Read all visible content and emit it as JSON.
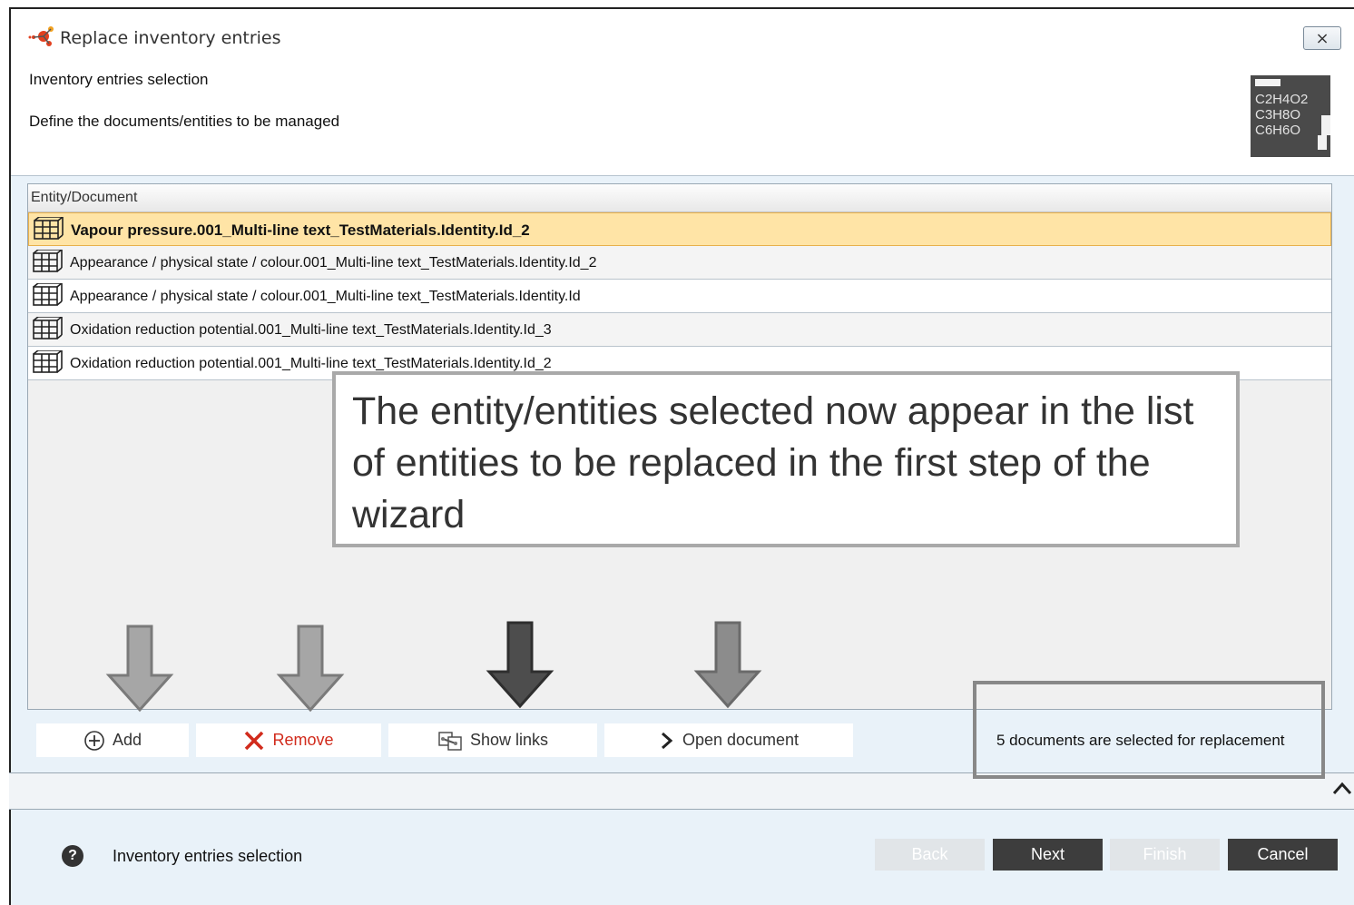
{
  "window": {
    "title": "Replace inventory entries",
    "close_label": "⨯"
  },
  "header": {
    "title": "Inventory entries selection",
    "subtitle": "Define the documents/entities to be managed",
    "logo_lines": [
      "C2H4O2",
      "C3H8O",
      "C6H6O"
    ]
  },
  "table": {
    "column_header": "Entity/Document",
    "rows": [
      "Vapour pressure.001_Multi-line text_TestMaterials.Identity.Id_2",
      "Appearance / physical state / colour.001_Multi-line text_TestMaterials.Identity.Id_2",
      "Appearance / physical state / colour.001_Multi-line text_TestMaterials.Identity.Id",
      "Oxidation reduction potential.001_Multi-line text_TestMaterials.Identity.Id_3",
      "Oxidation reduction potential.001_Multi-line text_TestMaterials.Identity.Id_2"
    ],
    "selected_index": 0
  },
  "callout": {
    "text": "The entity/entities selected now appear in the list of entities to be replaced in the first step of the wizard"
  },
  "toolbar": {
    "add_label": "Add",
    "remove_label": "Remove",
    "show_links_label": "Show links",
    "open_document_label": "Open document",
    "status": "5 documents are selected for replacement"
  },
  "footer": {
    "step_label": "Inventory entries selection",
    "back_label": "Back",
    "next_label": "Next",
    "finish_label": "Finish",
    "cancel_label": "Cancel"
  },
  "colors": {
    "selected_row": "#ffe4a6",
    "remove_red": "#d12b1c",
    "dark_button": "#3d3d3d",
    "arrow_light": "#a6a6a6",
    "arrow_dark": "#4d4d4d"
  }
}
